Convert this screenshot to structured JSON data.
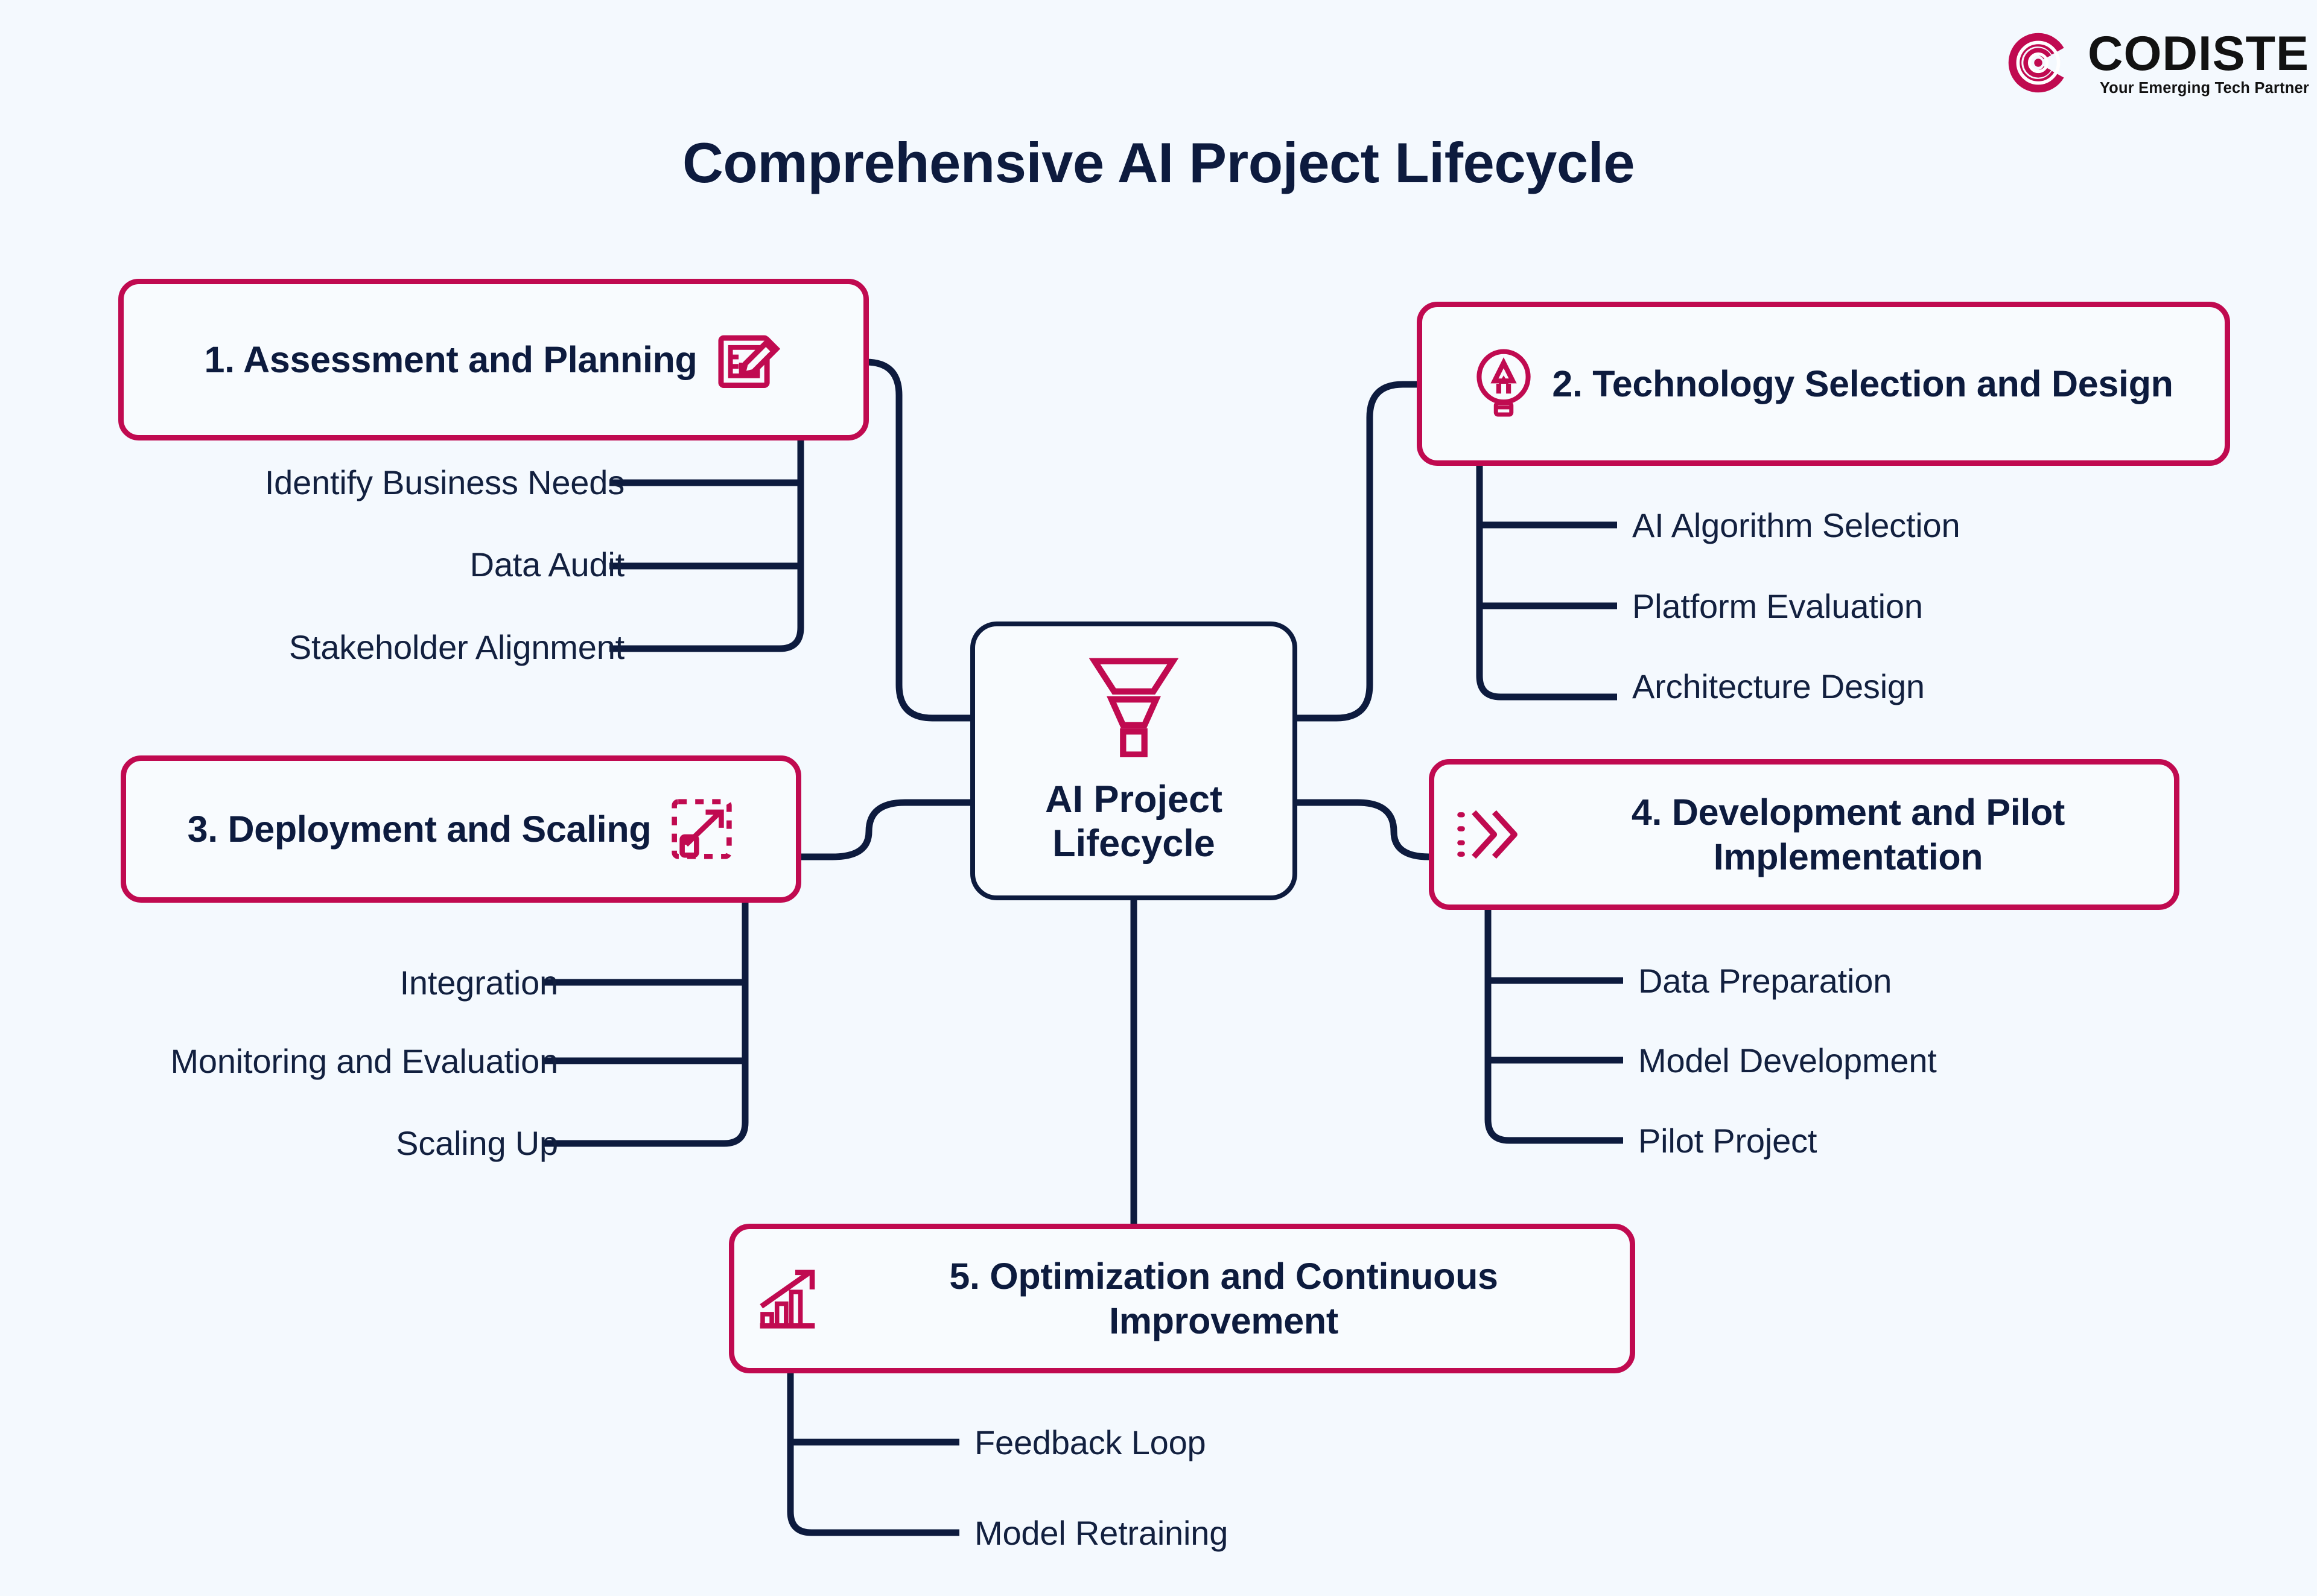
{
  "brand": {
    "name": "CODISTE",
    "tagline": "Your Emerging Tech Partner",
    "mark_color": "#c00a50"
  },
  "title": "Comprehensive AI Project Lifecycle",
  "theme": {
    "background": "#f4f9fe",
    "accent": "#c00a50",
    "ink": "#0d1b3e"
  },
  "center": {
    "line1": "AI Project",
    "line2": "Lifecycle",
    "icon": "funnel-icon"
  },
  "stages": [
    {
      "id": "assessment-and-planning",
      "label": "1. Assessment and Planning",
      "icon": "clipboard-pencil-icon",
      "icon_side": "right",
      "items": [
        "Identify Business Needs",
        "Data Audit",
        "Stakeholder Alignment"
      ]
    },
    {
      "id": "technology-selection-and-design",
      "label": "2. Technology Selection and Design",
      "icon": "lightbulb-pen-icon",
      "icon_side": "left",
      "items": [
        "AI Algorithm Selection",
        "Platform Evaluation",
        "Architecture Design"
      ]
    },
    {
      "id": "deployment-and-scaling",
      "label": "3. Deployment and Scaling",
      "icon": "scale-expand-icon",
      "icon_side": "right",
      "items": [
        "Integration",
        "Monitoring and Evaluation",
        "Scaling Up"
      ]
    },
    {
      "id": "development-and-pilot-implementation",
      "label": "4. Development and Pilot Implementation",
      "icon": "double-chevron-icon",
      "icon_side": "left",
      "items": [
        "Data Preparation",
        "Model Development",
        "Pilot Project"
      ]
    },
    {
      "id": "optimization-and-continuous-improvement",
      "label": "5. Optimization and Continuous Improvement",
      "icon": "growth-chart-icon",
      "icon_side": "left",
      "items": [
        "Feedback Loop",
        "Model Retraining"
      ]
    }
  ]
}
